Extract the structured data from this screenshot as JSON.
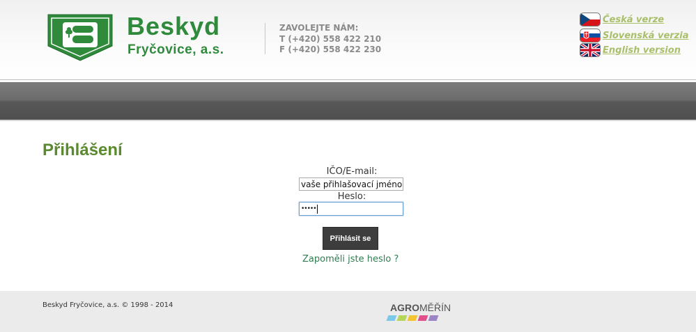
{
  "brand": {
    "name": "Beskyd",
    "subtitle": "Fryčovice, a.s.",
    "color": "#2f8a3c"
  },
  "contact": {
    "heading": "ZAVOLEJTE NÁM:",
    "phone": "T (+420) 558 422 210",
    "fax": "F (+420) 558 422 230"
  },
  "languages": [
    {
      "label": "Česká verze",
      "icon": "czech-flag-icon"
    },
    {
      "label": "Slovenská verzia",
      "icon": "slovak-flag-icon"
    },
    {
      "label": "English version",
      "icon": "uk-flag-icon"
    }
  ],
  "login": {
    "title": "Přihlášení",
    "username_label": "IČO/E-mail:",
    "username_value": "vaše přihlašovací jméno",
    "password_label": "Heslo:",
    "password_value": "•••••",
    "submit_label": "Přihlásit se",
    "forgot_label": "Zapoměli jste heslo ?"
  },
  "footer": {
    "copyright": "Beskyd Fryčovice, a.s. © 1998 - 2014",
    "partner_bold": "AGRO",
    "partner_rest": "MĚŘÍN",
    "partner_colors": [
      "#7cc8e8",
      "#b6d65a",
      "#f2c531",
      "#e0508a",
      "#9a86c4"
    ]
  },
  "colors": {
    "title_green": "#5a8a2e",
    "link_green": "#2f7d50",
    "lang_link": "#a9bf6a"
  }
}
